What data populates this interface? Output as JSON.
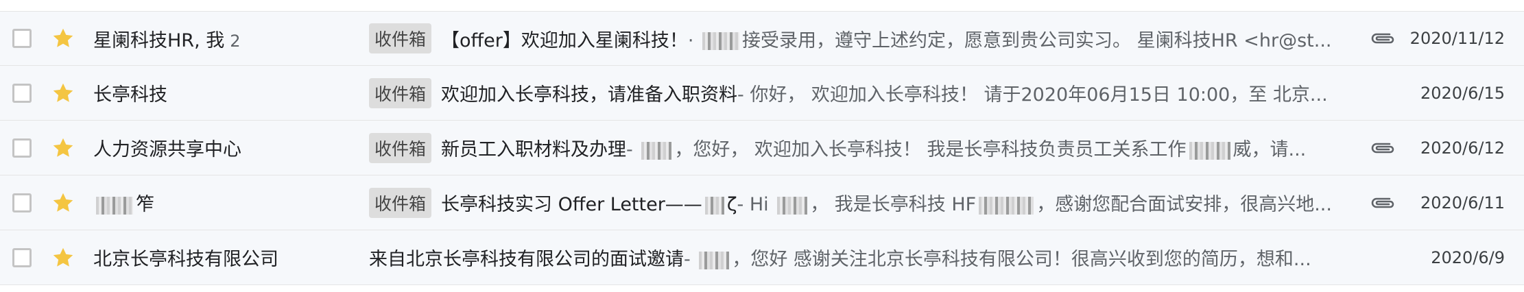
{
  "emails": [
    {
      "sender": "星阑科技HR, 我",
      "count": "2",
      "tag": "收件箱",
      "subject": "【offer】欢迎加入星阑科技！",
      "snippet_pre": " · ",
      "snippet_post": "接受录用，遵守上述约定，愿意到贵公司实习。 星阑科技HR <hr@st...",
      "has_attachment": true,
      "date": "2020/11/12"
    },
    {
      "sender": "长亭科技",
      "count": "",
      "tag": "收件箱",
      "subject": "欢迎加入长亭科技，请准备入职资料",
      "snippet_pre": " - 你好， 欢迎加入长亭科技！ 请于2020年06月15日 10:00，至 北京...",
      "snippet_post": "",
      "has_attachment": false,
      "date": "2020/6/15"
    },
    {
      "sender": "人力资源共享中心",
      "count": "",
      "tag": "收件箱",
      "subject": "新员工入职材料及办理",
      "snippet_pre": " - ",
      "snippet_post": "，您好， 欢迎加入长亭科技！ 我是长亭科技负责员工关系工作",
      "snippet_tail": "威，请...",
      "has_attachment": true,
      "date": "2020/6/12"
    },
    {
      "sender": "",
      "sender_suffix": "笮",
      "count": "",
      "tag": "收件箱",
      "subject": "长亭科技实习 Offer Letter——",
      "subject_suffix": "ζ",
      "snippet_pre": " - Hi ",
      "snippet_post": "， 我是长亭科技 HF",
      "snippet_tail": "，感谢您配合面试安排，很高兴地...",
      "has_attachment": true,
      "date": "2020/6/11"
    },
    {
      "sender": "北京长亭科技有限公司",
      "count": "",
      "tag": "",
      "subject": "来自北京长亭科技有限公司的面试邀请",
      "snippet_pre": " - ",
      "snippet_post": "，您好 感谢关注北京长亭科技有限公司！很高兴收到您的简历，想和...",
      "has_attachment": false,
      "date": "2020/6/9"
    }
  ],
  "icons": {
    "star": "star-icon",
    "attachment": "paperclip-icon",
    "checkbox": "checkbox"
  },
  "colors": {
    "star": "#f4c542",
    "tag_bg": "#dddddd",
    "snippet": "#5f6368"
  }
}
